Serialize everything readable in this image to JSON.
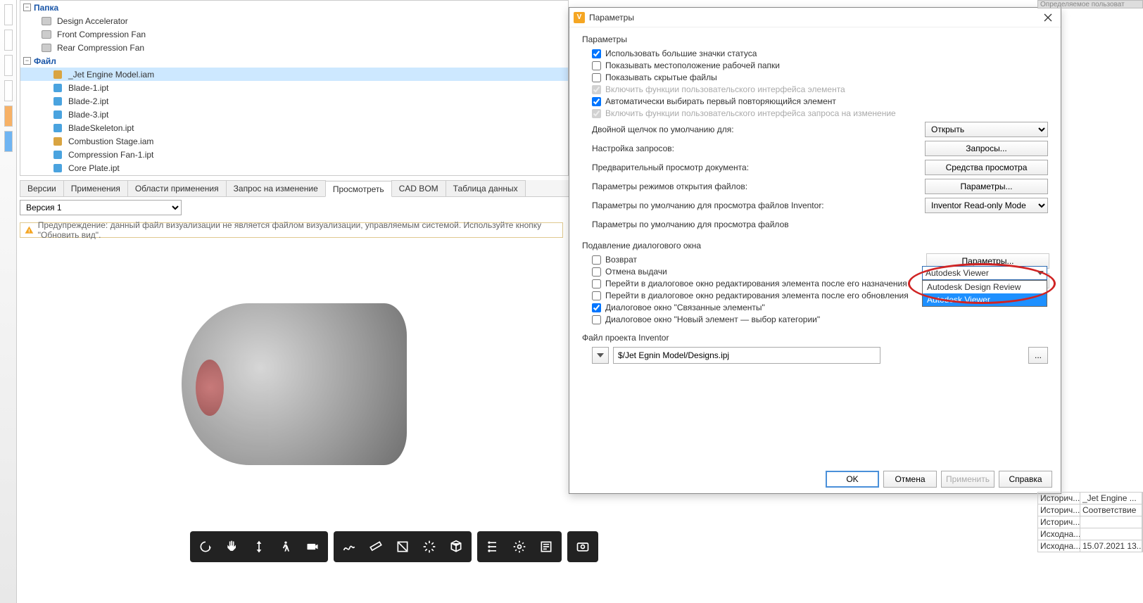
{
  "tree": {
    "root_folder_label": "Папка",
    "folders": [
      "Design Accelerator",
      "Front Compression Fan",
      "Rear Compression Fan"
    ],
    "file_label": "Файл",
    "files": [
      {
        "name": "_Jet Engine Model.iam",
        "type": "iam",
        "selected": true
      },
      {
        "name": "Blade-1.ipt",
        "type": "ipt"
      },
      {
        "name": "Blade-2.ipt",
        "type": "ipt"
      },
      {
        "name": "Blade-3.ipt",
        "type": "ipt"
      },
      {
        "name": "BladeSkeleton.ipt",
        "type": "ipt"
      },
      {
        "name": "Combustion Stage.iam",
        "type": "iam"
      },
      {
        "name": "Compression Fan-1.ipt",
        "type": "ipt"
      },
      {
        "name": "Core Plate.ipt",
        "type": "ipt"
      }
    ]
  },
  "tabs": [
    "Версии",
    "Применения",
    "Области применения",
    "Запрос на изменение",
    "Просмотреть",
    "CAD BOM",
    "Таблица данных"
  ],
  "active_tab_index": 4,
  "version_selected": "Версия 1",
  "warning": "Предупреждение: данный файл визуализации не является файлом визуализации, управляемым системой. Используйте кнопку \"Обновить вид\".",
  "dialog": {
    "title": "Параметры",
    "group_params": "Параметры",
    "checks": [
      {
        "label": "Использовать большие значки статуса",
        "checked": true,
        "disabled": false
      },
      {
        "label": "Показывать местоположение рабочей папки",
        "checked": false,
        "disabled": false
      },
      {
        "label": "Показывать скрытые файлы",
        "checked": false,
        "disabled": false
      },
      {
        "label": "Включить функции пользовательского интерфейса элемента",
        "checked": true,
        "disabled": true
      },
      {
        "label": "Автоматически выбирать первый повторяющийся элемент",
        "checked": true,
        "disabled": false
      },
      {
        "label": "Включить функции пользовательского интерфейса запроса на изменение",
        "checked": true,
        "disabled": true
      }
    ],
    "rows": [
      {
        "label": "Двойной щелчок по умолчанию для:",
        "control": "select",
        "value": "Открыть"
      },
      {
        "label": "Настройка запросов:",
        "control": "button",
        "value": "Запросы..."
      },
      {
        "label": "Предварительный просмотр документа:",
        "control": "button",
        "value": "Средства просмотра"
      },
      {
        "label": "Параметры режимов открытия файлов:",
        "control": "button",
        "value": "Параметры..."
      },
      {
        "label": "Параметры по умолчанию для просмотра файлов Inventor:",
        "control": "select",
        "value": "Inventor Read-only Mode"
      },
      {
        "label": "Параметры по умолчанию для просмотра файлов",
        "control": "select",
        "value": "Autodesk Viewer"
      }
    ],
    "dropdown_open": {
      "selected": "Autodesk Viewer",
      "items": [
        "Autodesk Design Review",
        "Autodesk Viewer"
      ]
    },
    "group_suppress": "Подавление диалогового окна",
    "suppress_checks": [
      {
        "label": "Возврат",
        "checked": false
      },
      {
        "label": "Отмена выдачи",
        "checked": false
      },
      {
        "label": "Перейти в диалоговое окно редактирования элемента после его назначения",
        "checked": false
      },
      {
        "label": "Перейти в диалоговое окно редактирования элемента после его обновления",
        "checked": false
      },
      {
        "label": "Диалоговое окно \"Связанные элементы\"",
        "checked": true
      },
      {
        "label": "Диалоговое окно \"Новый элемент — выбор категории\"",
        "checked": false
      }
    ],
    "suppress_right_buttons": [
      "Параметры...",
      "Параметры..."
    ],
    "project_group": "Файл проекта Inventor",
    "project_path": "$/Jet Egnin Model/Designs.ipj",
    "browse_label": "...",
    "footer": {
      "ok": "OK",
      "cancel": "Отмена",
      "apply": "Применить",
      "help": "Справка"
    }
  },
  "right_top_stub": "Определяемое пользоват",
  "right_table": [
    {
      "k": "Историч...",
      "v": "_Jet Engine ..."
    },
    {
      "k": "Историч...",
      "v": "Соответствие"
    },
    {
      "k": "Историч...",
      "v": ""
    },
    {
      "k": "Исходна...",
      "v": ""
    },
    {
      "k": "Исходна...",
      "v": "15.07.2021 13..."
    }
  ],
  "toolbar_icons": [
    "orbit",
    "pan",
    "updown",
    "walk",
    "camera",
    "freehand",
    "measure",
    "section",
    "explode",
    "cube",
    "tree",
    "settings",
    "props",
    "screenshot"
  ]
}
